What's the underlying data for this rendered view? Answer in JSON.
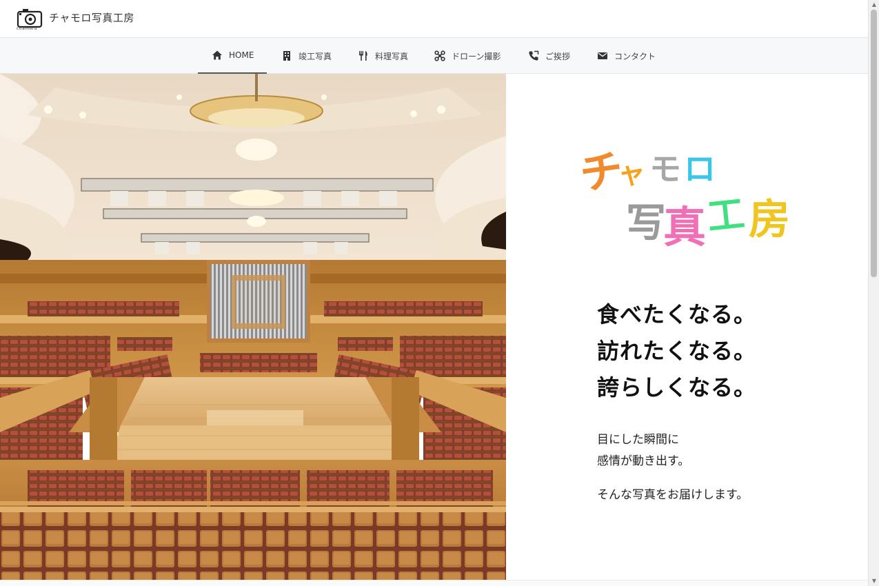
{
  "header": {
    "site_name": "チャモロ写真工房",
    "logo_label": "chamoru"
  },
  "nav": {
    "items": [
      {
        "label": "HOME",
        "icon": "home-icon",
        "active": true
      },
      {
        "label": "竣工写真",
        "icon": "building-icon",
        "active": false
      },
      {
        "label": "料理写真",
        "icon": "fork-knife-icon",
        "active": false
      },
      {
        "label": "ドローン撮影",
        "icon": "drone-icon",
        "active": false
      },
      {
        "label": "ご挨拶",
        "icon": "phone-icon",
        "active": false
      },
      {
        "label": "コンタクト",
        "icon": "mail-icon",
        "active": false
      }
    ]
  },
  "hero": {
    "subject": "concert-hall-photo"
  },
  "brand_art": {
    "line1": [
      "チ",
      "ャ",
      "モ",
      "ロ"
    ],
    "line2": [
      "写",
      "真",
      "工",
      "房"
    ],
    "colors": [
      "#f08a2c",
      "#f6a21f",
      "#a7a7a7",
      "#39c6e8",
      "#9a9a9a",
      "#f06fb7",
      "#7a7a7a",
      "#40e080",
      "#f0c520"
    ]
  },
  "catchcopy": {
    "lines": [
      "食べたくなる。",
      "訪れたくなる。",
      "誇らしくなる。"
    ]
  },
  "lead": {
    "lines": [
      "目にした瞬間に",
      "感情が動き出す。"
    ],
    "closing": "そんな写真をお届けします。"
  }
}
